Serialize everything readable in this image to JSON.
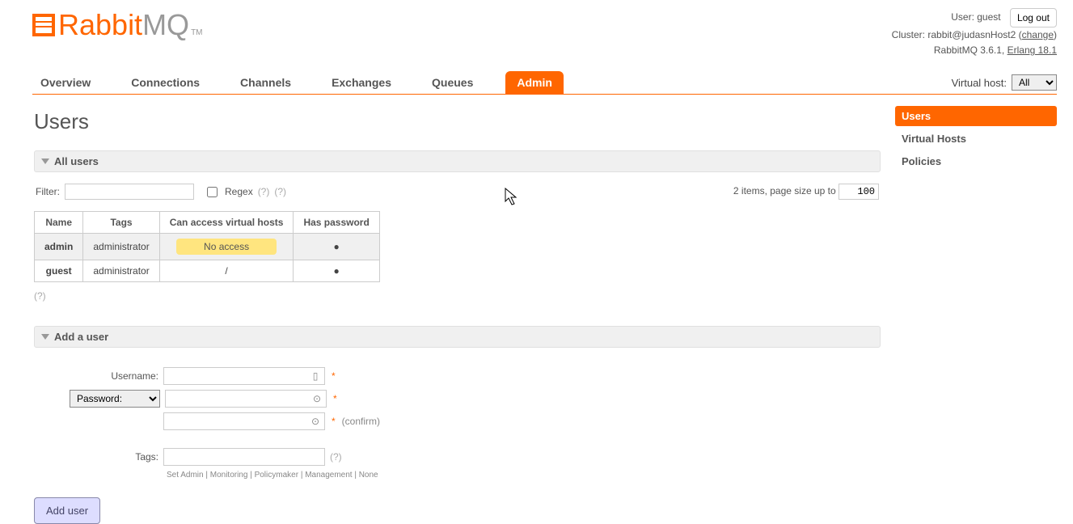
{
  "header": {
    "logo_text1": "Rabbit",
    "logo_text2": "MQ",
    "user_label": "User:",
    "user": "guest",
    "logout": "Log out",
    "cluster_label": "Cluster:",
    "cluster": "rabbit@judasnHost2",
    "change": "change",
    "version": "RabbitMQ 3.6.1,",
    "erlang": "Erlang 18.1"
  },
  "nav": {
    "tabs": [
      "Overview",
      "Connections",
      "Channels",
      "Exchanges",
      "Queues",
      "Admin"
    ],
    "vhost_label": "Virtual host:",
    "vhost_value": "All"
  },
  "page_title": "Users",
  "section_all_users": "All users",
  "filter": {
    "label": "Filter:",
    "value": "",
    "regex_label": "Regex",
    "help1": "(?)",
    "help2": "(?)",
    "items_label": "2 items, page size up to",
    "page_size": "100"
  },
  "table": {
    "headers": [
      "Name",
      "Tags",
      "Can access virtual hosts",
      "Has password"
    ],
    "rows": [
      {
        "name": "admin",
        "tags": "administrator",
        "vhost": "No access",
        "vhost_noaccess": true,
        "password": "●",
        "highlight": true
      },
      {
        "name": "guest",
        "tags": "administrator",
        "vhost": "/",
        "vhost_noaccess": false,
        "password": "●",
        "highlight": false
      }
    ],
    "help": "(?)"
  },
  "section_add_user": "Add a user",
  "form": {
    "username_label": "Username:",
    "password_label": "Password:",
    "confirm_label": "(confirm)",
    "tags_label": "Tags:",
    "tags_help": "(?)",
    "tag_hint": "Set   Admin | Monitoring | Policymaker | Management | None",
    "submit": "Add user"
  },
  "sidebar": {
    "items": [
      {
        "label": "Users",
        "active": true
      },
      {
        "label": "Virtual Hosts",
        "active": false
      },
      {
        "label": "Policies",
        "active": false
      }
    ]
  }
}
